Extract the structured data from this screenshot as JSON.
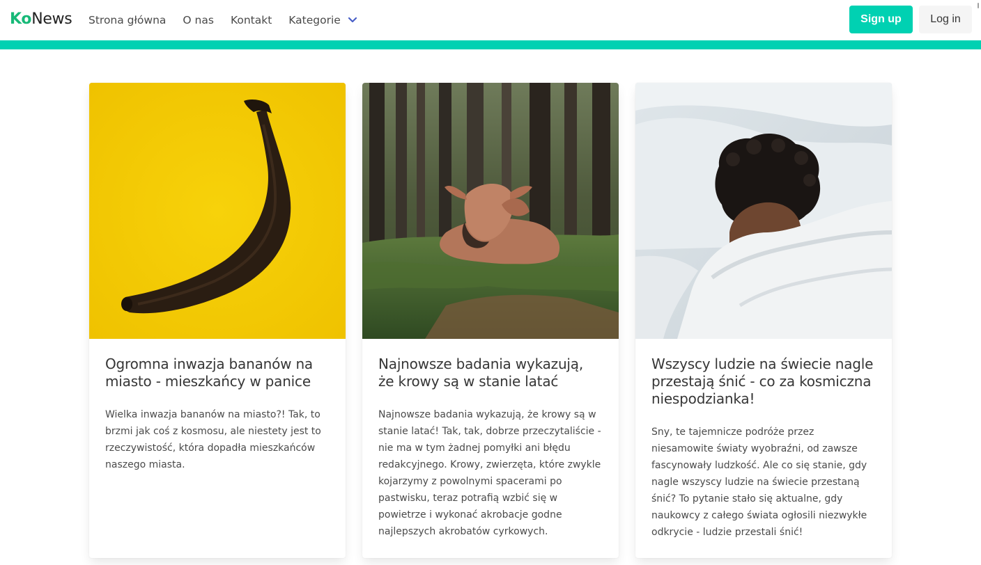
{
  "brand": {
    "part1": "Ko",
    "part2": "News"
  },
  "nav": {
    "home": "Strona główna",
    "about": "O nas",
    "contact": "Kontakt",
    "categories": "Kategorie"
  },
  "auth": {
    "signup": "Sign up",
    "login": "Log in"
  },
  "colors": {
    "accent": "#00d1b2",
    "brand_green": "#17b978"
  },
  "articles": [
    {
      "image": "banana-photo",
      "title": "Ogromna inwazja bananów na miasto - mieszkańcy w panice",
      "text": "Wielka inwazja bananów na miasto?! Tak, to brzmi jak coś z kosmosu, ale niestety jest to rzeczywistość, która dopadła mieszkańców naszego miasta."
    },
    {
      "image": "cow-photo",
      "title": "Najnowsze badania wykazują, że krowy są w stanie latać",
      "text": "Najnowsze badania wykazują, że krowy są w stanie latać! Tak, tak, dobrze przeczytaliście - nie ma w tym żadnej pomyłki ani błędu redakcyjnego. Krowy, zwierzęta, które zwykle kojarzymy z powolnymi spacerami po pastwisku, teraz potrafią wzbić się w powietrze i wykonać akrobacje godne najlepszych akrobatów cyrkowych."
    },
    {
      "image": "sleeping-person-photo",
      "title": "Wszyscy ludzie na świecie nagle przestają śnić - co za kosmiczna niespodzianka!",
      "text": "Sny, te tajemnicze podróże przez niesamowite światy wyobraźni, od zawsze fascynowały ludzkość. Ale co się stanie, gdy nagle wszyscy ludzie na świecie przestaną śnić? To pytanie stało się aktualne, gdy naukowcy z całego świata ogłosili niezwykłe odkrycie - ludzie przestali śnić!"
    }
  ]
}
